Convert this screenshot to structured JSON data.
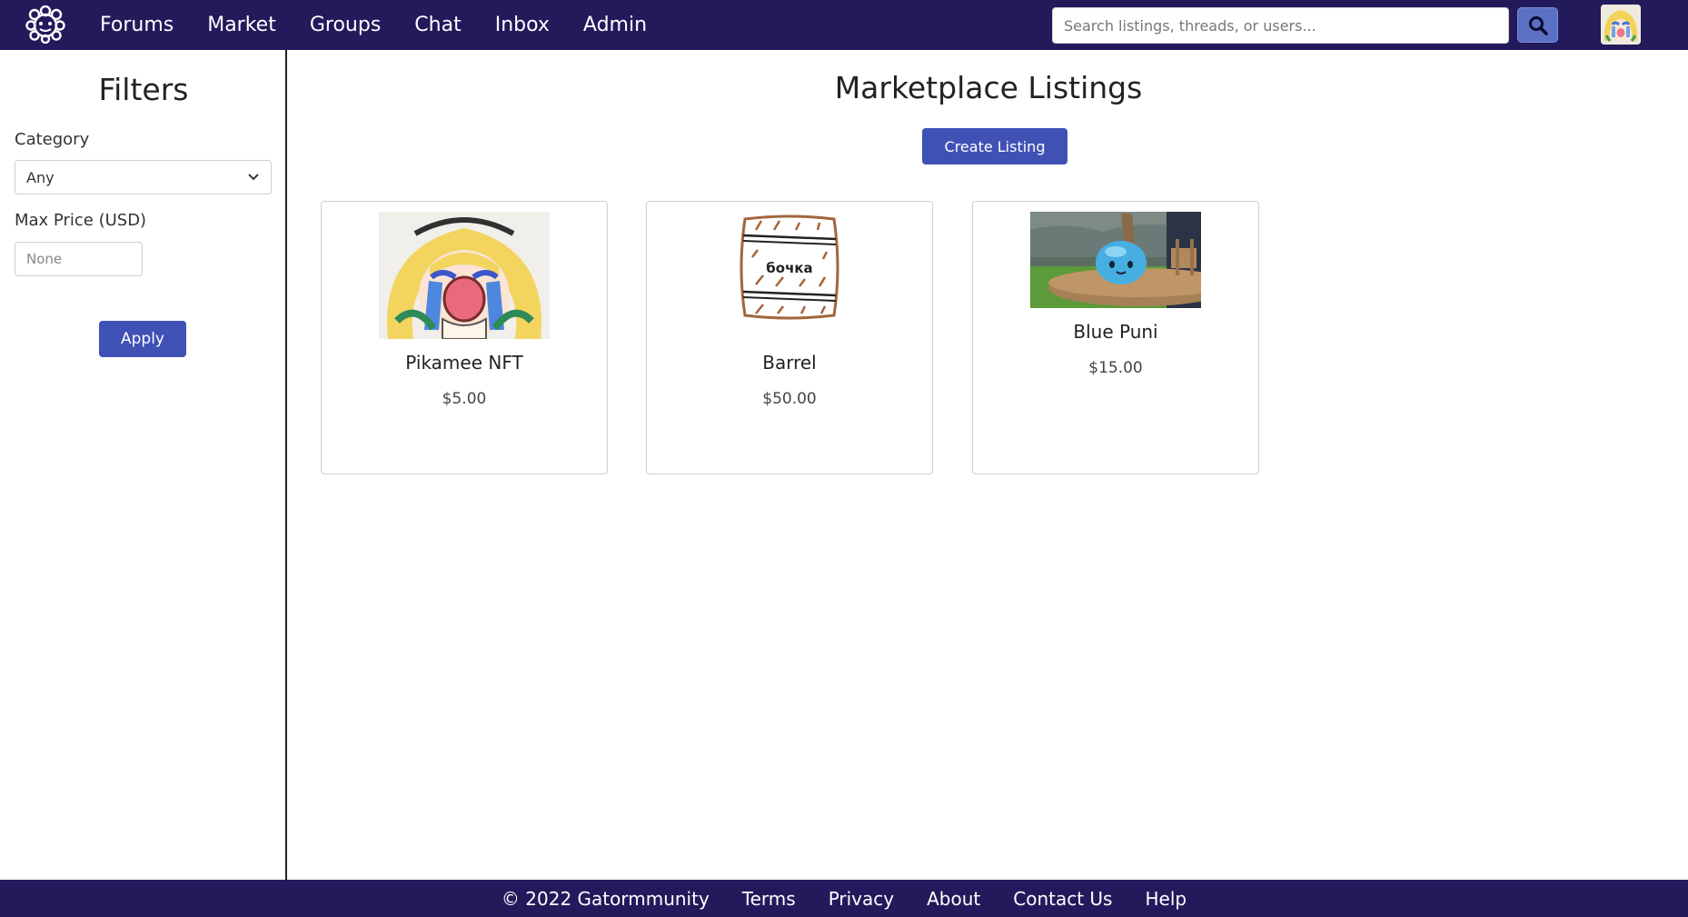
{
  "nav": {
    "logo_icon": "gator-paw-logo-icon",
    "items": [
      "Forums",
      "Market",
      "Groups",
      "Chat",
      "Inbox",
      "Admin"
    ]
  },
  "search": {
    "placeholder": "Search listings, threads, or users...",
    "button_icon": "search-icon"
  },
  "user": {
    "avatar_icon": "user-avatar"
  },
  "filters": {
    "title": "Filters",
    "category_label": "Category",
    "category_value": "Any",
    "max_price_label": "Max Price (USD)",
    "max_price_placeholder": "None",
    "apply_label": "Apply"
  },
  "main": {
    "title": "Marketplace Listings",
    "create_label": "Create Listing"
  },
  "listings": [
    {
      "name": "Pikamee NFT",
      "price": "$5.00",
      "image": "anime-crying-girl-image"
    },
    {
      "name": "Barrel",
      "price": "$50.00",
      "image": "barrel-sketch-image",
      "image_text": "бочка"
    },
    {
      "name": "Blue Puni",
      "price": "$15.00",
      "image": "blue-puni-image"
    }
  ],
  "footer": {
    "copyright": "© 2022 Gatormmunity",
    "links": [
      "Terms",
      "Privacy",
      "About",
      "Contact Us",
      "Help"
    ]
  },
  "colors": {
    "nav_bg": "#231a5c",
    "primary_button": "#4051b5",
    "search_button": "#5b6fc4"
  }
}
